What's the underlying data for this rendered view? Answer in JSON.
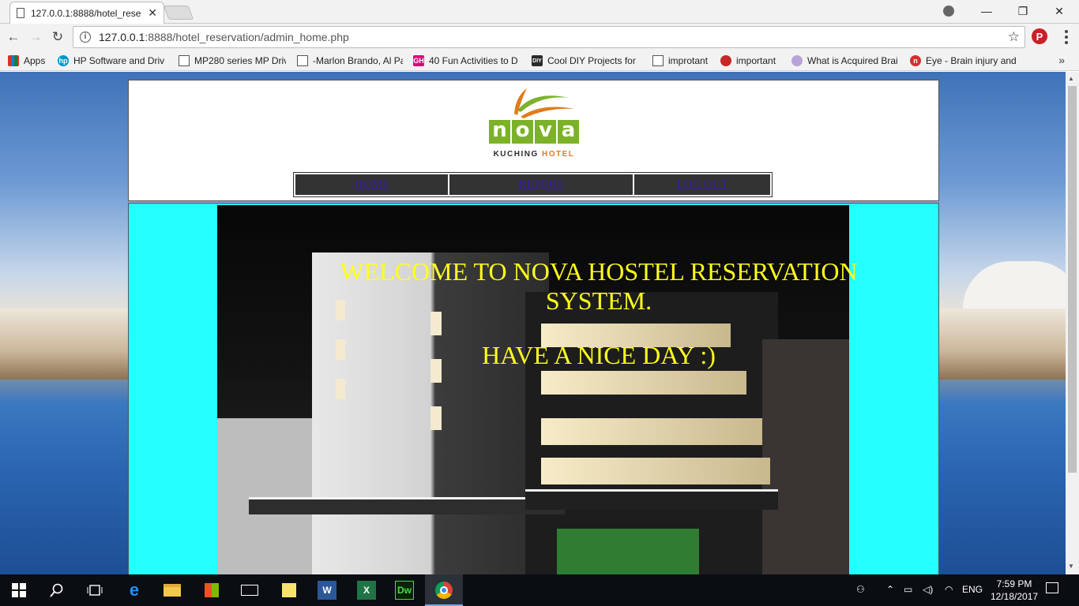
{
  "browser": {
    "tab_title": "127.0.0.1:8888/hotel_rese",
    "url_host": "127.0.0.1",
    "url_path": ":8888/hotel_reservation/admin_home.php",
    "bookmarks": [
      {
        "label": "Apps",
        "icon": "apps-grid-icon"
      },
      {
        "label": "HP Software and Driv",
        "icon": "hp-logo-icon"
      },
      {
        "label": "MP280 series MP Driv",
        "icon": "page-icon"
      },
      {
        "label": "-Marlon Brando, Al Pa",
        "icon": "page-icon"
      },
      {
        "label": "40 Fun Activities to D",
        "icon": "gh-logo-icon"
      },
      {
        "label": "Cool DIY Projects for",
        "icon": "diy-logo-icon"
      },
      {
        "label": "improtant",
        "icon": "page-icon"
      },
      {
        "label": "important",
        "icon": "apple-icon"
      },
      {
        "label": "What is Acquired Brai",
        "icon": "brain-icon"
      },
      {
        "label": "Eye - Brain injury and",
        "icon": "n-logo-icon"
      }
    ]
  },
  "page": {
    "logo": {
      "letters": [
        "n",
        "o",
        "v",
        "a"
      ],
      "sub_left": "KUCHING",
      "sub_right": "HOTEL"
    },
    "nav": [
      {
        "label": "HOME"
      },
      {
        "label": "REPORT"
      },
      {
        "label": "LOG OUT"
      }
    ],
    "welcome": "WELCOME TO NOVA HOSTEL RESERVATION SYSTEM.",
    "greeting": "HAVE A NICE DAY :)"
  },
  "taskbar": {
    "language": "ENG",
    "time": "7:59 PM",
    "date": "12/18/2017"
  },
  "colors": {
    "accent_text": "#ffff1a",
    "main_bg": "#24ffff",
    "nav_bg": "#333333",
    "nav_link": "#3a1aa8",
    "logo_green": "#7cb22a",
    "logo_orange": "#e07b1c"
  }
}
